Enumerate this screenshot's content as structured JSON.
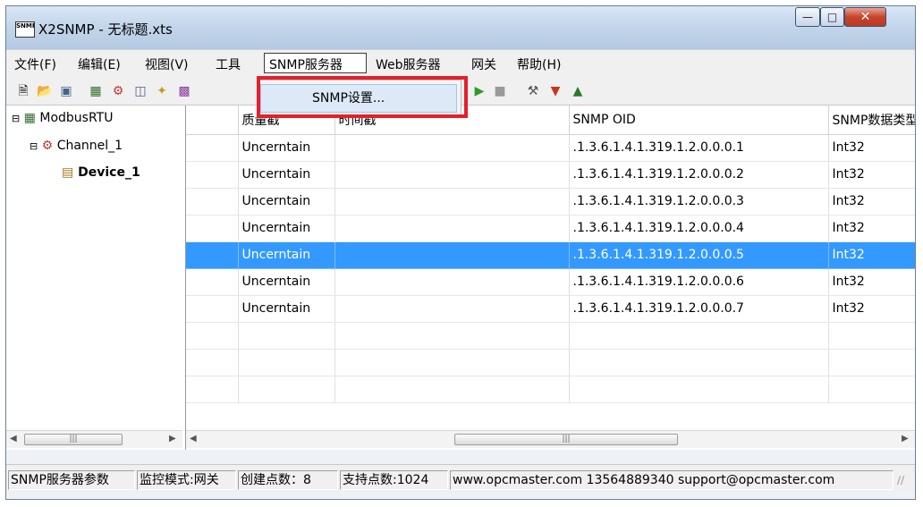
{
  "window": {
    "title": "X2SNMP - 无标题.xts",
    "app_icon_text": "SNMP"
  },
  "menu": {
    "items": [
      "文件(F)",
      "编辑(E)",
      "视图(V)",
      "工具",
      "SNMP服务器",
      "Web服务器",
      "网关",
      "帮助(H)"
    ]
  },
  "dropdown": {
    "items": [
      "SNMP设置..."
    ]
  },
  "tree": {
    "items": [
      "ModbusRTU",
      "Channel_1",
      "Device_1"
    ]
  },
  "grid": {
    "columns": [
      "",
      "质量戳",
      "时间戳",
      "SNMP OID",
      "SNMP数据类型"
    ],
    "rows": [
      {
        "quality": "Uncerntain",
        "time": "",
        "oid": ".1.3.6.1.4.1.319.1.2.0.0.0.1",
        "type": "Int32"
      },
      {
        "quality": "Uncerntain",
        "time": "",
        "oid": ".1.3.6.1.4.1.319.1.2.0.0.0.2",
        "type": "Int32"
      },
      {
        "quality": "Uncerntain",
        "time": "",
        "oid": ".1.3.6.1.4.1.319.1.2.0.0.0.3",
        "type": "Int32"
      },
      {
        "quality": "Uncerntain",
        "time": "",
        "oid": ".1.3.6.1.4.1.319.1.2.0.0.0.4",
        "type": "Int32"
      },
      {
        "quality": "Uncerntain",
        "time": "",
        "oid": ".1.3.6.1.4.1.319.1.2.0.0.0.5",
        "type": "Int32"
      },
      {
        "quality": "Uncerntain",
        "time": "",
        "oid": ".1.3.6.1.4.1.319.1.2.0.0.0.6",
        "type": "Int32"
      },
      {
        "quality": "Uncerntain",
        "time": "",
        "oid": ".1.3.6.1.4.1.319.1.2.0.0.0.7",
        "type": "Int32"
      }
    ],
    "selected_row": 4
  },
  "status": {
    "cells": [
      "SNMP服务器参数",
      "监控模式:网关",
      "创建点数：8",
      "支持点数:1024",
      "www.opcmaster.com 13564889340 support@opcmaster.com"
    ]
  },
  "colors": {
    "selection": "#3399ff",
    "highlight_box": "#e5202a"
  },
  "icons": [
    "new-icon",
    "open-icon",
    "save-icon",
    "add-channel-icon",
    "add-device-icon",
    "add-tag-icon",
    "new-tag-icon",
    "db-icon",
    "start-icon",
    "stop-icon",
    "tools-icon",
    "load-icon",
    "upload-icon"
  ]
}
